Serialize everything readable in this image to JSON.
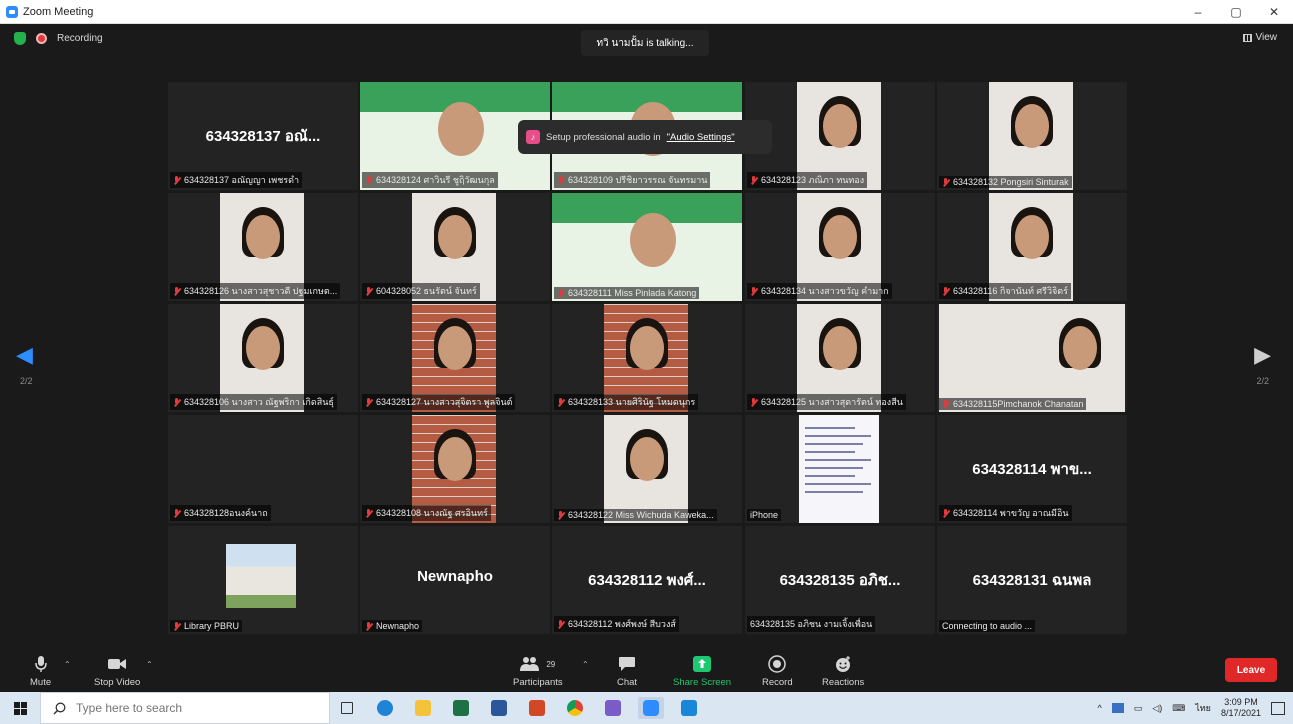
{
  "window": {
    "title": "Zoom Meeting",
    "controls": [
      "–",
      "▢",
      "✕"
    ]
  },
  "meeting": {
    "recording_label": "Recording",
    "talking_indicator": "ทวิ นามปั้ม is talking...",
    "view_label": "View",
    "page_left": "2/2",
    "page_right": "2/2",
    "toast": {
      "text": "Setup professional audio in",
      "link": "\"Audio Settings\""
    }
  },
  "tiles": [
    {
      "name": "634328137 อณัญญา เพชรดำ",
      "bigname": "634328137 อณั...",
      "kind": "name",
      "muted": true
    },
    {
      "name": "634328124 ศาวินรี ชูฤิวัฒนกุล",
      "kind": "video-slide",
      "muted": true
    },
    {
      "name": "634328109 ปรีชิยาวรรณ จันทรมาน",
      "kind": "video-slide",
      "muted": true
    },
    {
      "name": "634328123 ภณิภา ทนทอง",
      "kind": "video-person",
      "muted": true
    },
    {
      "name": "634328132 Pongsiri Sinturak",
      "kind": "video-person",
      "muted": true
    },
    {
      "name": "634328126 นางสาวสุชาวดี ปฐมเกษต...",
      "kind": "video-person",
      "muted": true
    },
    {
      "name": "604328052 ธนรัตน์ จันทร์",
      "kind": "video-person",
      "muted": true
    },
    {
      "name": "634328111 Miss Pinlada Katong",
      "kind": "video-slide",
      "muted": true
    },
    {
      "name": "634328134 นางสาวขวัญ คำมาก",
      "kind": "video-person",
      "muted": true
    },
    {
      "name": "634328116 กิจานันท์ ศรีวิจิตร์",
      "kind": "video-person",
      "muted": true
    },
    {
      "name": "634328106 นางสาว ณัฐพริกา เกิดสินธุ์",
      "kind": "video-person",
      "muted": true
    },
    {
      "name": "634328127 นางสาวสุจิตรา พูลจินต์",
      "kind": "video-person",
      "muted": true
    },
    {
      "name": "634328133 นายศิรินัฐ โหมดนุกร",
      "kind": "video-person",
      "muted": true
    },
    {
      "name": "634328125 นางสาวสุดารัตน์ ทองสีน",
      "kind": "video-person",
      "muted": true
    },
    {
      "name": "634328115Pimchanok Chanatan",
      "kind": "video-person",
      "muted": true
    },
    {
      "name": "634328128อนงค์นาถ",
      "kind": "name",
      "bigname": "",
      "muted": true
    },
    {
      "name": "634328108 นางณัฐ ศรอินทร์",
      "kind": "video-person",
      "muted": true
    },
    {
      "name": "634328122 Miss Wichuda Kaweka...",
      "kind": "video-person",
      "muted": true
    },
    {
      "name": "iPhone",
      "kind": "video-doc",
      "muted": false
    },
    {
      "name": "634328114 พาขวัญ อาณมีอิน",
      "bigname": "634328114 พาข...",
      "kind": "name",
      "muted": true
    },
    {
      "name": "Library PBRU",
      "kind": "video-building",
      "muted": true
    },
    {
      "name": "Newnapho",
      "bigname": "Newnapho",
      "kind": "name",
      "muted": true
    },
    {
      "name": "634328112 พงศ์พงษ์ สีบวงส์",
      "bigname": "634328112 พงศ์...",
      "kind": "name",
      "muted": true
    },
    {
      "name": "634328135 อภิชน งามเจิ้งเพื่อน",
      "bigname": "634328135 อภิช...",
      "kind": "name",
      "muted": false
    },
    {
      "name": "Connecting to audio ...",
      "bigname": "634328131 ฉนพล",
      "kind": "name",
      "muted": false
    }
  ],
  "toolbar": {
    "mute": "Mute",
    "stop_video": "Stop Video",
    "participants": "Participants",
    "participants_count": "29",
    "chat": "Chat",
    "share_screen": "Share Screen",
    "record": "Record",
    "reactions": "Reactions",
    "leave": "Leave"
  },
  "taskbar": {
    "search_placeholder": "Type here to search",
    "time": "3:09 PM",
    "date": "8/17/2021",
    "lang": "ไทย"
  },
  "colors": {
    "accent": "#2d8cff",
    "leave": "#e02828",
    "share": "#1cc870",
    "mute_red": "#e23b3b"
  }
}
